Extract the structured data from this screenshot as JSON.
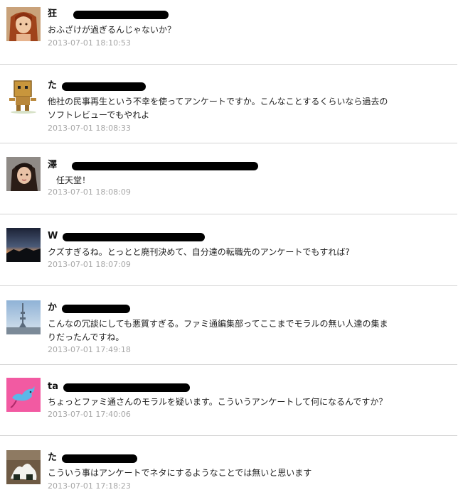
{
  "comments": [
    {
      "name": "狂",
      "text": "おふざけが過ぎるんじゃないか？",
      "timestamp": "2013-07-01 18:10:53",
      "avatar_icon": "anime-portrait-avatar"
    },
    {
      "name": "た",
      "text": "他社の民事再生という不幸を使ってアンケートですか。こんなことするくらいなら過去のソフトレビューでもやれよ",
      "timestamp": "2013-07-01 18:08:33",
      "avatar_icon": "cardboard-robot-avatar"
    },
    {
      "name": "澤",
      "text": "　任天堂！",
      "timestamp": "2013-07-01 18:08:09",
      "avatar_icon": "woman-photo-avatar"
    },
    {
      "name": "W",
      "text": "クズすぎるね。とっとと廃刊決めて、自分達の転職先のアンケートでもすれば?",
      "timestamp": "2013-07-01 18:07:09",
      "avatar_icon": "dusk-landscape-avatar"
    },
    {
      "name": "か",
      "text": "こんなの冗談にしても悪質すぎる。ファミ通編集部ってここまでモラルの無い人達の集まりだったんですね。",
      "timestamp": "2013-07-01 17:49:18",
      "avatar_icon": "tower-skyline-avatar"
    },
    {
      "name": "ta",
      "text": "ちょっとファミ通さんのモラルを疑います。こういうアンケートして何になるんですか？",
      "timestamp": "2013-07-01 17:40:06",
      "avatar_icon": "blue-bird-avatar"
    },
    {
      "name": "た",
      "text": "こういう事はアンケートでネタにするようなことでは無いと思います",
      "timestamp": "2013-07-01 17:18:23",
      "avatar_icon": "rice-ball-avatar"
    }
  ]
}
